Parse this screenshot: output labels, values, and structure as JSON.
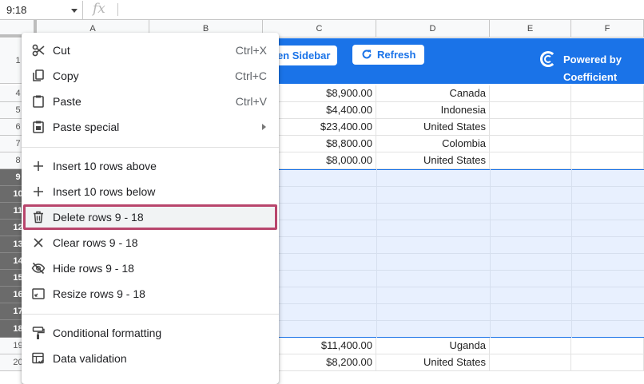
{
  "formula_bar": {
    "name_box": "9:18",
    "fx_label": "fx"
  },
  "columns": [
    "A",
    "B",
    "C",
    "D",
    "E",
    "F"
  ],
  "banner": {
    "open_sidebar": "pen Sidebar",
    "refresh": "Refresh",
    "powered_by": "Powered by Coefficient"
  },
  "rows": [
    {
      "num": "1",
      "c": "",
      "d": ""
    },
    {
      "num": "4",
      "c": "$8,900.00",
      "d": "Canada"
    },
    {
      "num": "5",
      "c": "$4,400.00",
      "d": "Indonesia"
    },
    {
      "num": "6",
      "c": "$23,400.00",
      "d": "United States"
    },
    {
      "num": "7",
      "c": "$8,800.00",
      "d": "Colombia"
    },
    {
      "num": "8",
      "c": "$8,000.00",
      "d": "United States"
    },
    {
      "num": "9",
      "c": "",
      "d": ""
    },
    {
      "num": "10",
      "c": "",
      "d": ""
    },
    {
      "num": "11",
      "c": "",
      "d": ""
    },
    {
      "num": "12",
      "c": "",
      "d": ""
    },
    {
      "num": "13",
      "c": "",
      "d": ""
    },
    {
      "num": "14",
      "c": "",
      "d": ""
    },
    {
      "num": "15",
      "c": "",
      "d": ""
    },
    {
      "num": "16",
      "c": "",
      "d": ""
    },
    {
      "num": "17",
      "c": "",
      "d": ""
    },
    {
      "num": "18",
      "c": "",
      "d": ""
    },
    {
      "num": "19",
      "c": "$11,400.00",
      "d": "Uganda"
    },
    {
      "num": "20",
      "c": "$8,200.00",
      "d": "United States"
    }
  ],
  "menu": {
    "cut": {
      "label": "Cut",
      "shortcut": "Ctrl+X"
    },
    "copy": {
      "label": "Copy",
      "shortcut": "Ctrl+C"
    },
    "paste": {
      "label": "Paste",
      "shortcut": "Ctrl+V"
    },
    "paste_special": {
      "label": "Paste special"
    },
    "insert_above": {
      "label": "Insert 10 rows above"
    },
    "insert_below": {
      "label": "Insert 10 rows below"
    },
    "delete_rows": {
      "label": "Delete rows 9 - 18"
    },
    "clear_rows": {
      "label": "Clear rows 9 - 18"
    },
    "hide_rows": {
      "label": "Hide rows 9 - 18"
    },
    "resize_rows": {
      "label": "Resize rows 9 - 18"
    },
    "conditional_formatting": {
      "label": "Conditional formatting"
    },
    "data_validation": {
      "label": "Data validation"
    }
  },
  "colors": {
    "accent": "#1a73e8",
    "selection": "#e8f0fe",
    "highlight_border": "#b8456c"
  }
}
